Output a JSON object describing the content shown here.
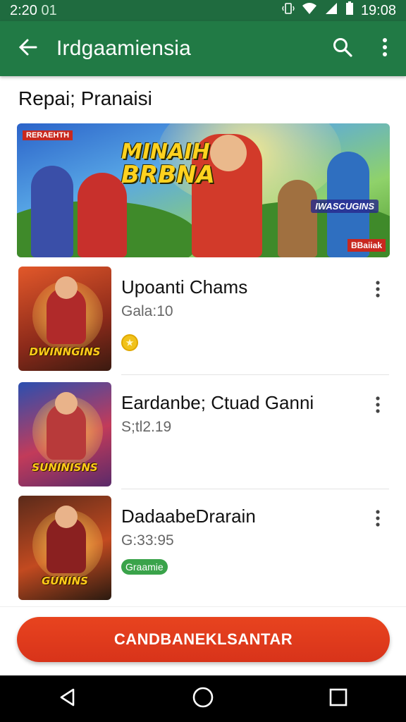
{
  "status_bar": {
    "time_left": "2:20",
    "time_left_extra": "01",
    "time_right": "19:08"
  },
  "app_bar": {
    "title": "Irdgaamiensia",
    "icons": [
      "back-arrow-icon",
      "search-icon",
      "more-vert-icon"
    ]
  },
  "section_title": "Repai; Pranaisi",
  "banner": {
    "headline_line1": "MINAIH",
    "headline_line2": "BRBNA",
    "tag": "IWASCUGINS",
    "corner_top_left": "RERAEHTH",
    "corner_bottom_right": "BBaiiak"
  },
  "games": [
    {
      "name": "Upoanti Chams",
      "subtitle": "Gala:10",
      "thumb_logo": "DWINNGINS",
      "extra": "coin"
    },
    {
      "name": "Eardanbe; Ctuad Ganni",
      "subtitle": "S;tl2.19",
      "thumb_logo": "SUNINISNS",
      "extra": ""
    },
    {
      "name": "DadaabeDrarain",
      "subtitle": "G:33:95",
      "thumb_logo": "GUNINS",
      "extra": "badge",
      "badge_label": "Graamie"
    }
  ],
  "cta_label": "CANDBANEKLSANTAR",
  "colors": {
    "app_bar": "#217a45",
    "status_bar": "#1f6b3f",
    "cta": "#e03a1c"
  }
}
